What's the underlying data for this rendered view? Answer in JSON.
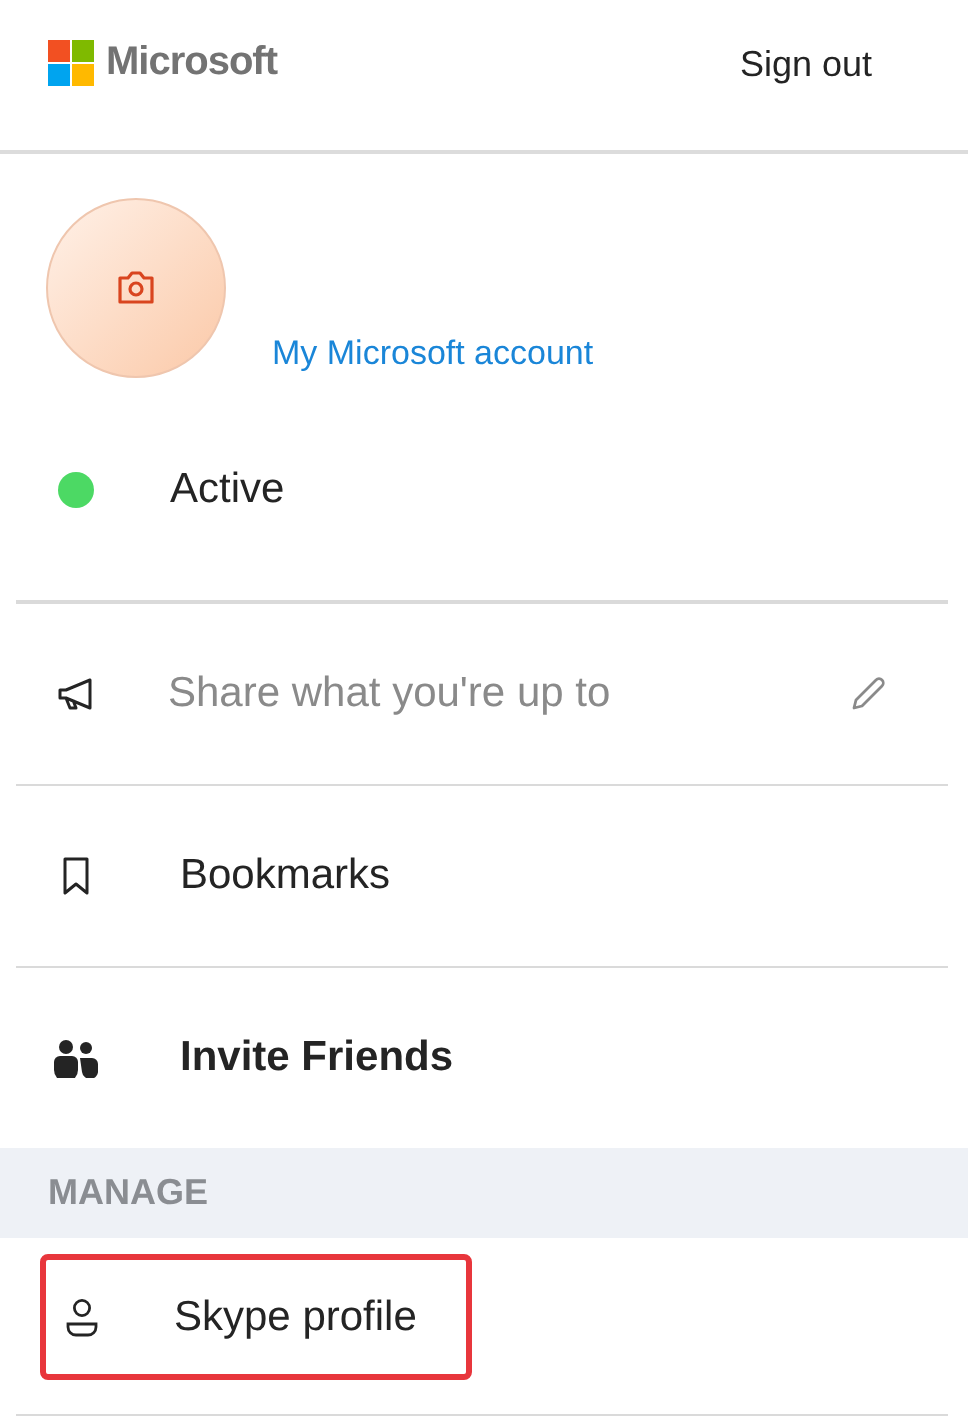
{
  "header": {
    "logo_text": "Microsoft",
    "sign_out": "Sign out"
  },
  "account": {
    "link": "My Microsoft account"
  },
  "presence": {
    "label": "Active",
    "color": "#4cd964"
  },
  "items": [
    {
      "kind": "share",
      "placeholder": "Share what you're up to"
    },
    {
      "kind": "bookmarks",
      "label": "Bookmarks"
    },
    {
      "kind": "invite",
      "label": "Invite Friends"
    }
  ],
  "manage": {
    "heading": "MANAGE",
    "items": [
      {
        "kind": "profile",
        "label": "Skype profile",
        "highlighted": true
      }
    ]
  }
}
